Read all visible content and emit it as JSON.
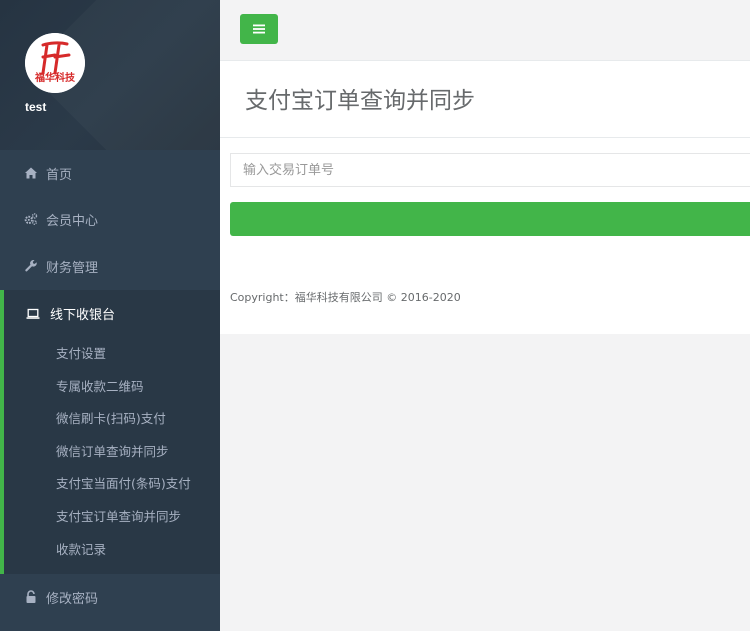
{
  "sidebar": {
    "logo_text": "福华科技",
    "username": "test",
    "items": [
      {
        "label": "首页",
        "icon": "home-icon"
      },
      {
        "label": "会员中心",
        "icon": "cogs-icon"
      },
      {
        "label": "财务管理",
        "icon": "wrench-icon"
      },
      {
        "label": "线下收银台",
        "icon": "laptop-icon"
      },
      {
        "label": "修改密码",
        "icon": "unlock-icon"
      }
    ],
    "submenu": [
      "支付设置",
      "专属收款二维码",
      "微信刷卡(扫码)支付",
      "微信订单查询并同步",
      "支付宝当面付(条码)支付",
      "支付宝订单查询并同步",
      "收款记录"
    ]
  },
  "header": {
    "menu_icon": "hamburger-icon"
  },
  "main": {
    "title": "支付宝订单查询并同步",
    "order_input": {
      "placeholder": "输入交易订单号",
      "value": ""
    },
    "submit_label": "",
    "footer": "Copyright：福华科技有限公司 © 2016-2020"
  },
  "colors": {
    "sidebar_bg": "#2f4050",
    "active_bg": "#293846",
    "accent_green": "#42b549"
  }
}
